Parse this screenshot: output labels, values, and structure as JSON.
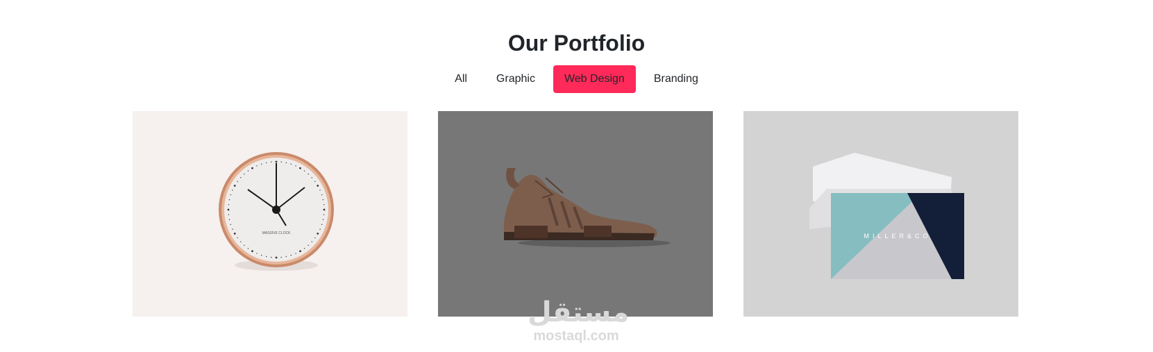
{
  "section": {
    "title": "Our Portfolio"
  },
  "filters": [
    {
      "label": "All",
      "active": false
    },
    {
      "label": "Graphic",
      "active": false
    },
    {
      "label": "Web Design",
      "active": true
    },
    {
      "label": "Branding",
      "active": false
    }
  ],
  "colors": {
    "accent": "#ff2a5a",
    "text": "#212529",
    "card1_bg": "#f6f0ee",
    "card2_bg": "#777777",
    "card3_bg": "#d3d3d3"
  },
  "portfolio": {
    "items": [
      {
        "category": "Web Design",
        "subject": "clock-image",
        "clock_text": "MASSIVE CLOCK"
      },
      {
        "category": "Web Design",
        "subject": "sneaker-image",
        "overlay": true
      },
      {
        "category": "Web Design",
        "subject": "business-card-image",
        "brand_text": "MILLER&CO"
      }
    ]
  },
  "watermark": {
    "arabic": "مستقل",
    "latin": "mostaql.com"
  }
}
